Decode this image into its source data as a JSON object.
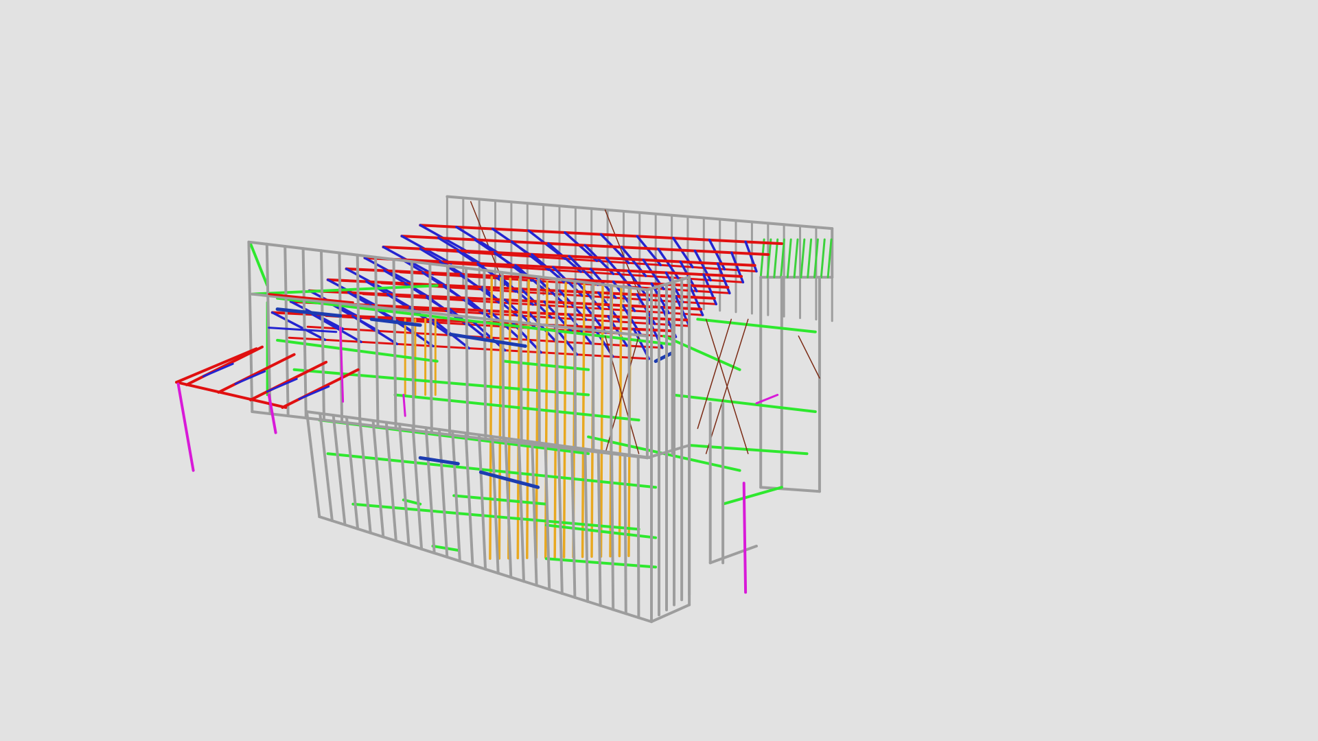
{
  "viewer": {
    "background_color": "#e2e2e2"
  },
  "model": {
    "description_icon": "steel-frame-house-3d-model",
    "member_colors": {
      "wall_frame": "#9d9d9d",
      "wall_frame_highlight": "#d0d0d0",
      "noggings": "#2ee82e",
      "roof_truss_chord": "#e01010",
      "truss_web": "#2424d0",
      "lintel": "#1c3cb0",
      "timber_studs": "#e8a820",
      "bracing": "#7a2a14",
      "posts": "#d81ad8",
      "end_truss": "#3cd13c"
    }
  }
}
